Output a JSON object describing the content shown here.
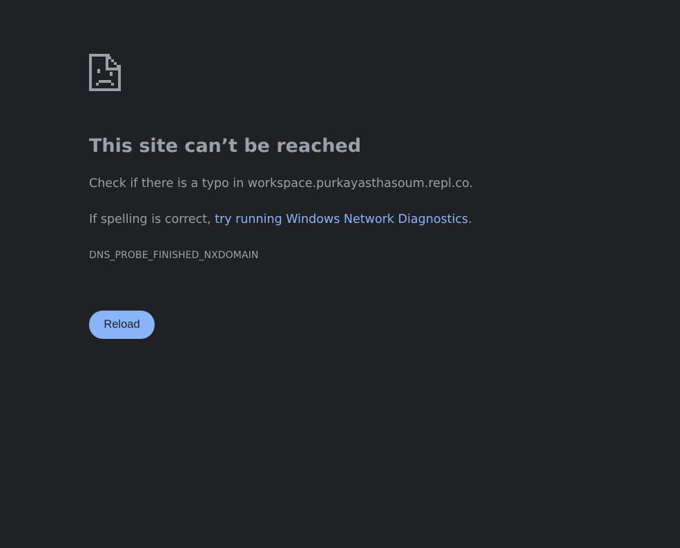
{
  "error": {
    "icon": "sad-page-icon",
    "title": "This site can’t be reached",
    "line1": "Check if there is a typo in workspace.purkayasthasoum.repl.co.",
    "line2_prefix": "If spelling is correct, ",
    "line2_link": "try running Windows Network Diagnostics",
    "line2_suffix": ".",
    "code": "DNS_PROBE_FINISHED_NXDOMAIN"
  },
  "actions": {
    "reload_label": "Reload"
  },
  "colors": {
    "background": "#202124",
    "text": "#9aa0a6",
    "link": "#8ab4f8",
    "button": "#8ab4f8",
    "button_text": "#202124"
  }
}
